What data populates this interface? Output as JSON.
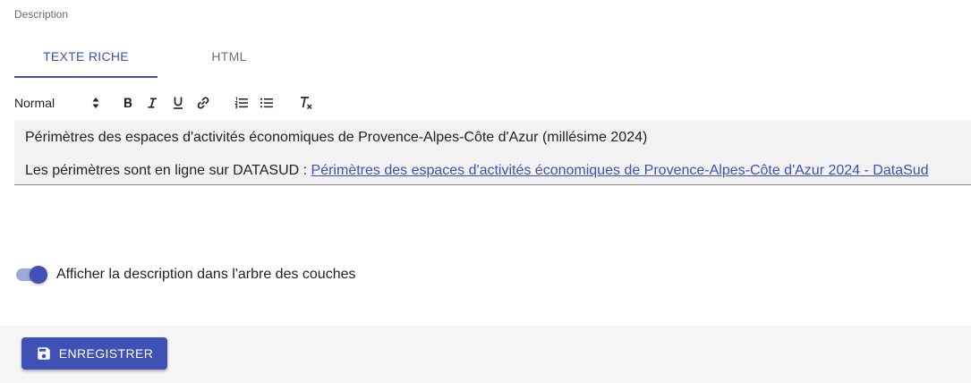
{
  "section": {
    "label": "Description"
  },
  "tabs": [
    {
      "label": "TEXTE RICHE",
      "active": true
    },
    {
      "label": "HTML",
      "active": false
    }
  ],
  "toolbar": {
    "format_select": "Normal",
    "buttons": [
      {
        "icon": "bold-icon"
      },
      {
        "icon": "italic-icon"
      },
      {
        "icon": "underline-icon"
      },
      {
        "icon": "link-icon"
      },
      {
        "icon": "ordered-list-icon"
      },
      {
        "icon": "bullet-list-icon"
      },
      {
        "icon": "clear-format-icon"
      }
    ]
  },
  "editor": {
    "paragraph1": "Périmètres des espaces d'activités économiques de Provence-Alpes-Côte d'Azur (millésime 2024)",
    "paragraph2_prefix": "Les périmètres sont en ligne sur DATASUD : ",
    "paragraph2_link": "Périmètres des espaces d'activités économiques de Provence-Alpes-Côte d'Azur 2024 - DataSud"
  },
  "toggle": {
    "label": "Afficher la description dans l'arbre des couches",
    "checked": true
  },
  "footer": {
    "save_label": "ENREGISTRER",
    "save_icon": "save-icon"
  },
  "colors": {
    "accent": "#3f51b5",
    "accent_light": "#9fa8da",
    "editor_bg": "#f2f2f2",
    "footer_bg": "#f5f5f5"
  }
}
